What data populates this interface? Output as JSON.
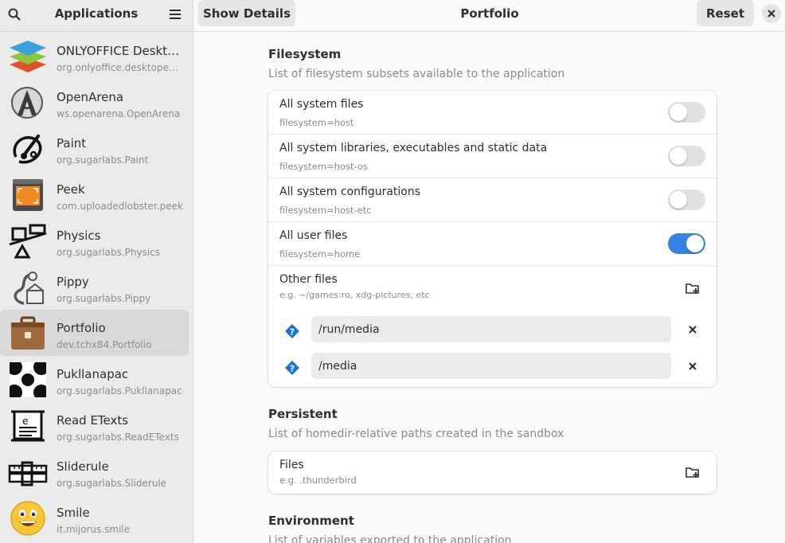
{
  "sidebar": {
    "title": "Applications",
    "apps": [
      {
        "name": "ONLYOFFICE Deskto…",
        "id": "org.onlyoffice.desktopedit…",
        "icon": "onlyoffice-icon"
      },
      {
        "name": "OpenArena",
        "id": "ws.openarena.OpenArena",
        "icon": "openarena-icon"
      },
      {
        "name": "Paint",
        "id": "org.sugarlabs.Paint",
        "icon": "paint-icon"
      },
      {
        "name": "Peek",
        "id": "com.uploadedlobster.peek",
        "icon": "peek-icon"
      },
      {
        "name": "Physics",
        "id": "org.sugarlabs.Physics",
        "icon": "physics-icon"
      },
      {
        "name": "Pippy",
        "id": "org.sugarlabs.Pippy",
        "icon": "pippy-icon"
      },
      {
        "name": "Portfolio",
        "id": "dev.tchx84.Portfolio",
        "icon": "portfolio-icon"
      },
      {
        "name": "Pukllanapac",
        "id": "org.sugarlabs.Pukllanapac",
        "icon": "pukllanapac-icon"
      },
      {
        "name": "Read ETexts",
        "id": "org.sugarlabs.ReadETexts",
        "icon": "read-etexts-icon"
      },
      {
        "name": "Sliderule",
        "id": "org.sugarlabs.Sliderule",
        "icon": "sliderule-icon"
      },
      {
        "name": "Smile",
        "id": "it.mijorus.smile",
        "icon": "smile-icon"
      }
    ]
  },
  "header": {
    "show_details": "Show Details",
    "title": "Portfolio",
    "reset": "Reset"
  },
  "filesystem": {
    "title": "Filesystem",
    "desc": "List of filesystem subsets available to the application",
    "rows": [
      {
        "title": "All system files",
        "sub": "filesystem=host",
        "enabled": false
      },
      {
        "title": "All system libraries, executables and static data",
        "sub": "filesystem=host-os",
        "enabled": false
      },
      {
        "title": "All system configurations",
        "sub": "filesystem=host-etc",
        "enabled": false
      },
      {
        "title": "All user files",
        "sub": "filesystem=home",
        "enabled": true
      }
    ],
    "other": {
      "title": "Other files",
      "sub": "e.g. ~/games:ro, xdg-pictures, etc",
      "paths": [
        "/run/media",
        "/media"
      ]
    }
  },
  "persistent": {
    "title": "Persistent",
    "desc": "List of homedir-relative paths created in the sandbox",
    "files_title": "Files",
    "files_sub": "e.g. .thunderbird"
  },
  "environment": {
    "title": "Environment",
    "desc": "List of variables exported to the application"
  },
  "colors": {
    "accent": "#3584e4",
    "sidebar_bg": "#ebebeb",
    "selected_bg": "#d9d9d9"
  }
}
